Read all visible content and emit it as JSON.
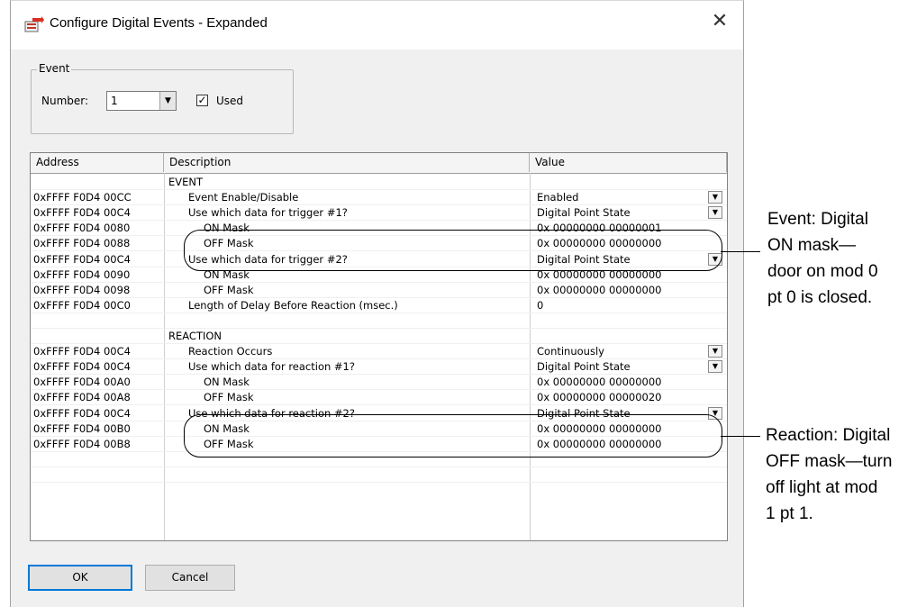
{
  "window": {
    "title": "Configure Digital Events - Expanded",
    "close_symbol": "✕"
  },
  "event_group": {
    "legend": "Event",
    "number_label": "Number:",
    "number_value": "1",
    "used_label": "Used",
    "used_checked": true
  },
  "table": {
    "columns": [
      "Address",
      "Description",
      "Value"
    ],
    "rows": [
      {
        "address": "",
        "description": "EVENT",
        "value": "",
        "indent": false,
        "dropdown": false
      },
      {
        "address": "0xFFFF F0D4 00CC",
        "description": "Event Enable/Disable",
        "value": "Enabled",
        "indent": true,
        "dropdown": true
      },
      {
        "address": "0xFFFF F0D4 00C4",
        "description": "Use which data for trigger #1?",
        "value": "Digital Point State",
        "indent": true,
        "dropdown": true
      },
      {
        "address": "0xFFFF F0D4 0080",
        "description": "ON Mask",
        "value": "0x 00000000  00000001",
        "indent": true,
        "sub": true,
        "dropdown": false
      },
      {
        "address": "0xFFFF F0D4 0088",
        "description": "OFF Mask",
        "value": "0x 00000000  00000000",
        "indent": true,
        "sub": true,
        "dropdown": false
      },
      {
        "address": "0xFFFF F0D4 00C4",
        "description": "Use which data for trigger #2?",
        "value": "Digital Point State",
        "indent": true,
        "dropdown": true
      },
      {
        "address": "0xFFFF F0D4 0090",
        "description": "ON Mask",
        "value": "0x 00000000  00000000",
        "indent": true,
        "sub": true,
        "dropdown": false
      },
      {
        "address": "0xFFFF F0D4 0098",
        "description": "OFF Mask",
        "value": "0x 00000000  00000000",
        "indent": true,
        "sub": true,
        "dropdown": false
      },
      {
        "address": "0xFFFF F0D4 00C0",
        "description": "Length of Delay Before Reaction (msec.)",
        "value": "0",
        "indent": true,
        "dropdown": false
      },
      {
        "address": "",
        "description": "",
        "value": "",
        "indent": false,
        "dropdown": false
      },
      {
        "address": "",
        "description": "REACTION",
        "value": "",
        "indent": false,
        "dropdown": false
      },
      {
        "address": "0xFFFF F0D4 00C4",
        "description": "Reaction Occurs",
        "value": "Continuously",
        "indent": true,
        "dropdown": true
      },
      {
        "address": "0xFFFF F0D4 00C4",
        "description": "Use which data for reaction #1?",
        "value": "Digital Point State",
        "indent": true,
        "dropdown": true
      },
      {
        "address": "0xFFFF F0D4 00A0",
        "description": "ON Mask",
        "value": "0x 00000000  00000000",
        "indent": true,
        "sub": true,
        "dropdown": false
      },
      {
        "address": "0xFFFF F0D4 00A8",
        "description": "OFF Mask",
        "value": "0x 00000000  00000020",
        "indent": true,
        "sub": true,
        "dropdown": false
      },
      {
        "address": "0xFFFF F0D4 00C4",
        "description": "Use which data for reaction #2?",
        "value": "Digital Point State",
        "indent": true,
        "dropdown": true
      },
      {
        "address": "0xFFFF F0D4 00B0",
        "description": "ON Mask",
        "value": "0x 00000000  00000000",
        "indent": true,
        "sub": true,
        "dropdown": false
      },
      {
        "address": "0xFFFF F0D4 00B8",
        "description": "OFF Mask",
        "value": "0x 00000000  00000000",
        "indent": true,
        "sub": true,
        "dropdown": false
      },
      {
        "address": "",
        "description": "",
        "value": "",
        "indent": false,
        "dropdown": false
      },
      {
        "address": "",
        "description": "",
        "value": "",
        "indent": false,
        "dropdown": false
      }
    ]
  },
  "buttons": {
    "ok": "OK",
    "cancel": "Cancel"
  },
  "callouts": {
    "event": [
      "Event: Digital",
      "ON mask—",
      "door on mod 0",
      "pt 0 is closed."
    ],
    "reaction": [
      "Reaction: Digital",
      "OFF mask—turn",
      "off light at mod",
      "1 pt 1."
    ]
  }
}
